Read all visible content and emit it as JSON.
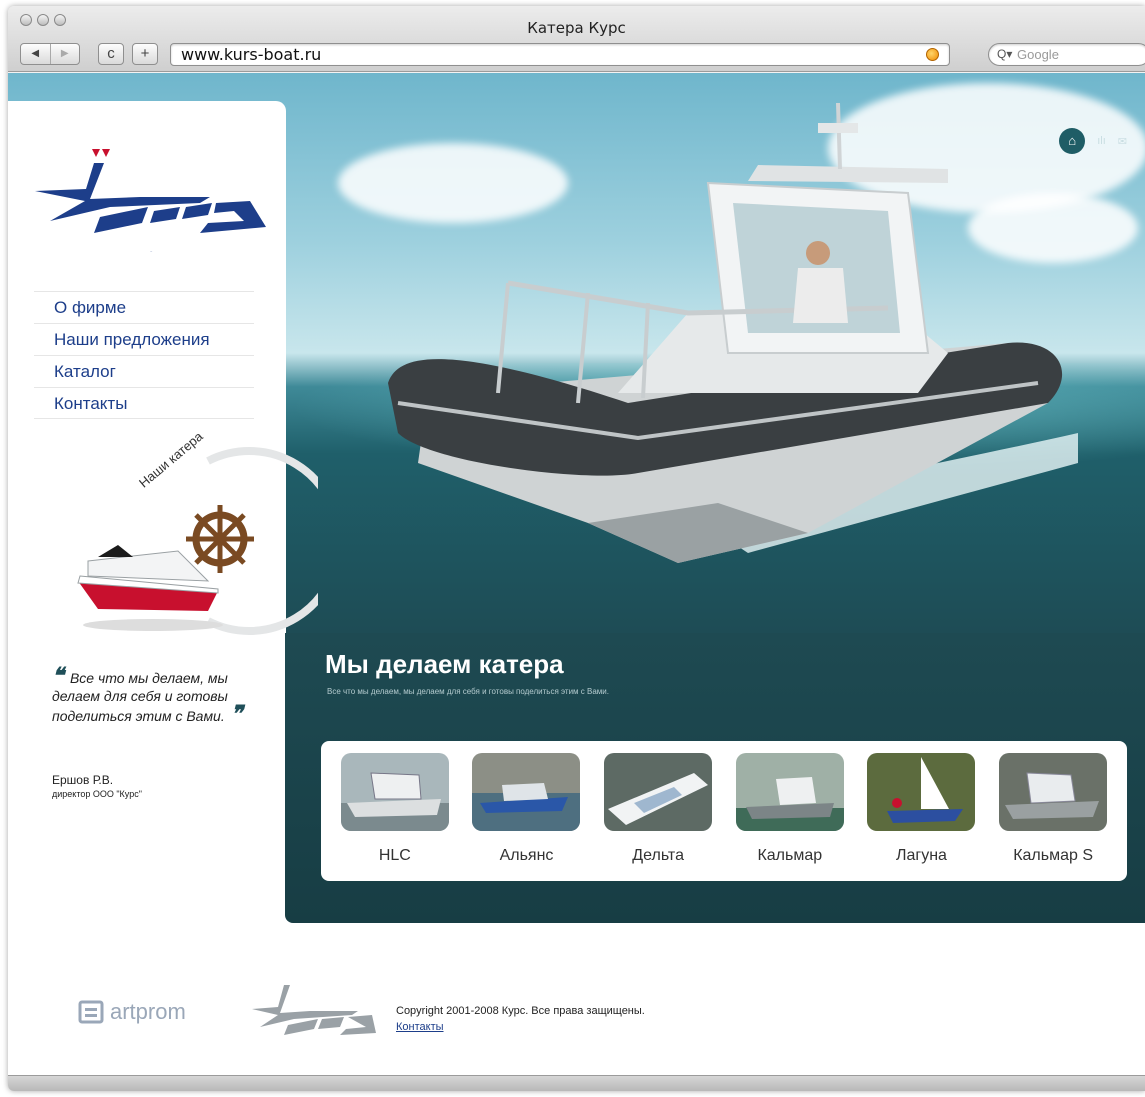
{
  "window": {
    "title": "Катера Курс"
  },
  "browser": {
    "url": "www.kurs-boat.ru",
    "search_placeholder": "Google",
    "reload_glyph": "c",
    "add_glyph": "+"
  },
  "logo": {
    "text": "Курс"
  },
  "menu": [
    {
      "label": "О фирме"
    },
    {
      "label": "Наши предложения"
    },
    {
      "label": "Каталог"
    },
    {
      "label": "Контакты"
    }
  ],
  "badge": {
    "title": "Наши катера"
  },
  "quote": {
    "text": "Все что мы делаем, мы делаем для себя и готовы поделиться этим с Вами.",
    "author": "Ершов Р.В.",
    "role": "директор ООО \"Курс\""
  },
  "section": {
    "title": "Мы делаем катера",
    "subtitle": "Все что мы делаем, мы делаем для себя и готовы поделиться этим с Вами."
  },
  "products": [
    {
      "label": "HLC"
    },
    {
      "label": "Альянс"
    },
    {
      "label": "Дельта"
    },
    {
      "label": "Кальмар"
    },
    {
      "label": "Лагуна"
    },
    {
      "label": "Кальмар S"
    }
  ],
  "footer": {
    "partner": "artprom",
    "copyright": "Copyright 2001-2008 Курс. Все права защищены.",
    "contacts_link": "Контакты"
  },
  "colors": {
    "brand_blue": "#1d3e8a",
    "teal_dark": "#1e4a52",
    "accent_red": "#c8102e"
  },
  "icons": [
    "home-icon",
    "sitemap-icon",
    "mail-icon",
    "rss-icon",
    "search-icon",
    "ship-wheel-icon",
    "quote-icon"
  ]
}
